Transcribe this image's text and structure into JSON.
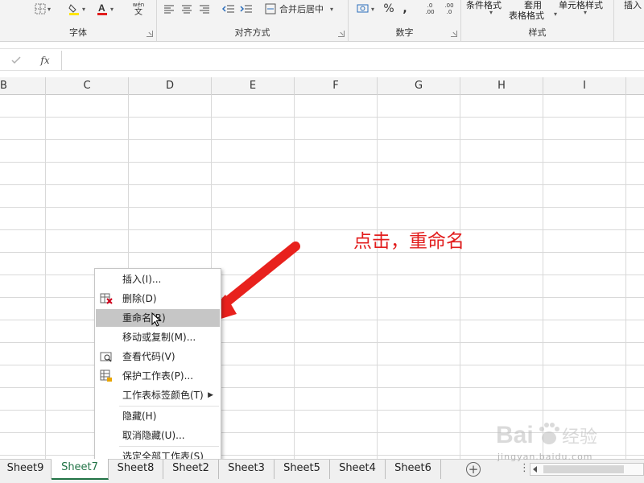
{
  "ribbon": {
    "font_group_label": "字体",
    "align_group_label": "对齐方式",
    "merge_label": "合并后居中",
    "number_group_label": "数字",
    "percent_symbol": "%",
    "comma_symbol": ",",
    "conditional_format": "条件格式",
    "table_format_top": "套用",
    "table_format_bottom": "表格格式",
    "cell_style": "单元格样式",
    "styles_group_label": "样式",
    "insert_label": "插入",
    "wen_label": "wén",
    "wen_char": "文",
    "dec_increase": ".00",
    "dec_decrease": ".0"
  },
  "formula_bar": {
    "fx_label": "fx",
    "value": ""
  },
  "columns": [
    "B",
    "C",
    "D",
    "E",
    "F",
    "G",
    "H",
    "I"
  ],
  "annotation": {
    "text": "点击，重命名",
    "color": "#e21d1d"
  },
  "context_menu": {
    "items": [
      {
        "label": "插入(I)..."
      },
      {
        "label": "删除(D)"
      },
      {
        "label": "重命名(R)"
      },
      {
        "label": "移动或复制(M)..."
      },
      {
        "label": "查看代码(V)"
      },
      {
        "label": "保护工作表(P)..."
      },
      {
        "label": "工作表标签颜色(T)"
      },
      {
        "label": "隐藏(H)"
      },
      {
        "label": "取消隐藏(U)..."
      },
      {
        "label": "选定全部工作表(S)"
      }
    ],
    "highlighted_index": 2
  },
  "sheet_tabs": [
    "Sheet9",
    "Sheet7",
    "Sheet8",
    "Sheet2",
    "Sheet3",
    "Sheet5",
    "Sheet4",
    "Sheet6"
  ],
  "active_sheet": "Sheet7",
  "colors": {
    "excel_green": "#217346",
    "arrow_red": "#e8211d",
    "menu_highlight": "#c6c6c6"
  },
  "watermark": {
    "brand_latin": "Bai",
    "brand_cn": "经验",
    "url": "jingyan.baidu.com"
  }
}
